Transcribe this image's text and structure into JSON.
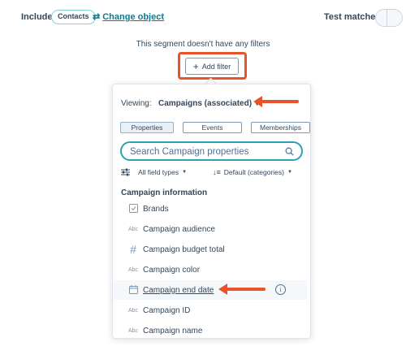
{
  "header": {
    "include_label": "Include",
    "object_pill": "Contacts",
    "change_object": "Change object",
    "test_matches": "Test matches"
  },
  "empty_state": "This segment doesn't have any filters",
  "add_filter": "Add filter",
  "panel": {
    "viewing_label": "Viewing:",
    "viewing_value": "Campaigns (associated)",
    "tabs": [
      "Properties",
      "Events",
      "Memberships"
    ],
    "active_tab": "Properties",
    "search_placeholder": "Search Campaign properties",
    "field_types": "All field types",
    "sort": "Default (categories)",
    "section": "Campaign information",
    "properties": [
      {
        "label": "Brands",
        "icon": "checkbox-list-icon"
      },
      {
        "label": "Campaign audience",
        "icon": "text-icon"
      },
      {
        "label": "Campaign budget total",
        "icon": "number-icon"
      },
      {
        "label": "Campaign color",
        "icon": "text-icon"
      },
      {
        "label": "Campaign end date",
        "icon": "calendar-icon",
        "hovered": true
      },
      {
        "label": "Campaign ID",
        "icon": "text-icon"
      },
      {
        "label": "Campaign name",
        "icon": "text-icon"
      }
    ]
  },
  "icon_glyphs": {
    "text": "Abc",
    "number": "#"
  },
  "colors": {
    "accent_teal": "#0b7a8f",
    "highlight_orange": "#e8542a",
    "text": "#33475b"
  }
}
